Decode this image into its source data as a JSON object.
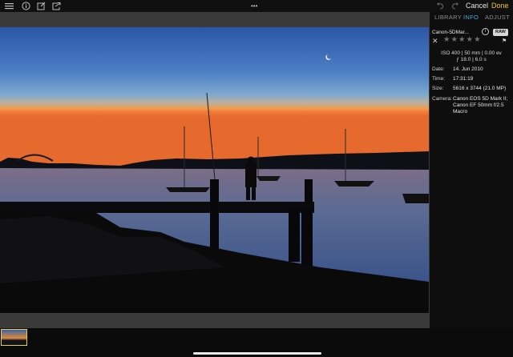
{
  "toolbar": {
    "menu_icon": "hamburger-icon",
    "info_icon": "info-icon",
    "edit_icon": "edit-icon",
    "export_icon": "export-icon",
    "more_glyph": "•••",
    "undo_icon": "undo-icon",
    "redo_icon": "redo-icon",
    "cancel_label": "Cancel",
    "done_label": "Done"
  },
  "tabs": [
    {
      "label": "LIBRARY"
    },
    {
      "label": "INFO"
    },
    {
      "label": "ADJUST"
    }
  ],
  "info": {
    "filename": "Canon-5DMar...",
    "raw_badge": "RAW",
    "info_badge_glyph": "i",
    "reject_glyph": "✕",
    "stars_glyph": "★★★★★",
    "flag_glyph": "⚑",
    "exif_line1": "ISO 400 | 50 mm | 0.00 ev",
    "exif_line2": "ƒ 18.0 | 6.0 s",
    "rows": [
      {
        "label": "Date:",
        "value": "14. Jun 2010"
      },
      {
        "label": "Time:",
        "value": "17:31:19"
      },
      {
        "label": "Size:",
        "value": "5616 x 3744 (21.0 MP)"
      },
      {
        "label": "Camera:",
        "value": "Canon EOS 5D Mark II; Canon EF 50mm f/2.5 Macro"
      }
    ]
  },
  "colors": {
    "accent": "#f0c419",
    "tab_active": "#4aa7d8",
    "tab_inactive": "#8c8c8c",
    "thumb_border": "#e7d13a"
  }
}
